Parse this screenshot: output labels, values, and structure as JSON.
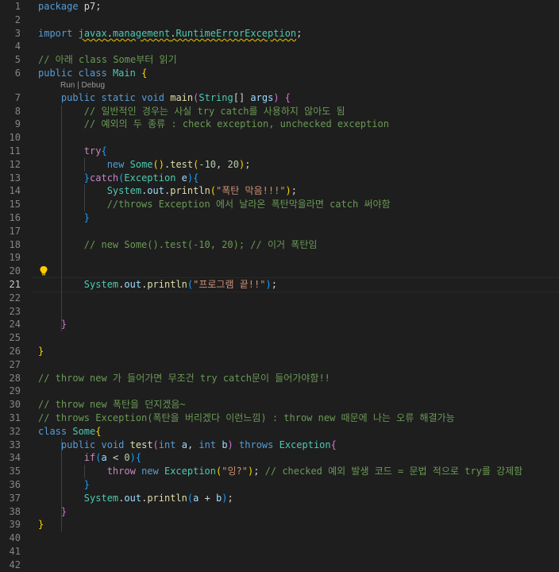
{
  "editor": {
    "active_line": 21,
    "codelens": {
      "run": "Run",
      "sep": "|",
      "debug": "Debug"
    },
    "lightbulb_icon": "lightbulb-icon",
    "colors": {
      "background": "#1e1e1e",
      "keyword": "#569cd6",
      "type": "#4ec9b0",
      "string": "#ce9178",
      "comment": "#6a9955",
      "number": "#b5cea8"
    },
    "line_numbers": [
      "1",
      "2",
      "3",
      "4",
      "5",
      "6",
      "7",
      "8",
      "9",
      "10",
      "11",
      "12",
      "13",
      "14",
      "15",
      "16",
      "17",
      "18",
      "19",
      "20",
      "21",
      "22",
      "23",
      "24",
      "25",
      "26",
      "27",
      "28",
      "29",
      "30",
      "31",
      "32",
      "33",
      "34",
      "35",
      "36",
      "37",
      "38",
      "39",
      "40",
      "41",
      "42"
    ],
    "lines": [
      [
        [
          "k",
          "package"
        ],
        [
          "p",
          " p7;"
        ]
      ],
      [],
      [
        [
          "k",
          "import"
        ],
        [
          "p",
          " "
        ],
        [
          "t warn",
          "javax"
        ],
        [
          "p warn",
          "."
        ],
        [
          "t warn",
          "management"
        ],
        [
          "p warn",
          "."
        ],
        [
          "t warn",
          "RuntimeErrorException"
        ],
        [
          "p",
          ";"
        ]
      ],
      [],
      [
        [
          "c",
          "// 아래 class Some부터 읽기"
        ]
      ],
      [
        [
          "k",
          "public"
        ],
        [
          "p",
          " "
        ],
        [
          "k",
          "class"
        ],
        [
          "p",
          " "
        ],
        [
          "t",
          "Main"
        ],
        [
          "p",
          " "
        ],
        [
          "b1",
          "{"
        ]
      ],
      [
        [
          "p",
          "    "
        ],
        [
          "k",
          "public"
        ],
        [
          "p",
          " "
        ],
        [
          "k",
          "static"
        ],
        [
          "p",
          " "
        ],
        [
          "k",
          "void"
        ],
        [
          "p",
          " "
        ],
        [
          "f",
          "main"
        ],
        [
          "b2",
          "("
        ],
        [
          "t",
          "String"
        ],
        [
          "p",
          "[] "
        ],
        [
          "v",
          "args"
        ],
        [
          "b2",
          ")"
        ],
        [
          "p",
          " "
        ],
        [
          "b2",
          "{"
        ]
      ],
      [
        [
          "p",
          "        "
        ],
        [
          "c",
          "// 일반적인 경우는 사실 try catch를 사용하지 않아도 됨"
        ]
      ],
      [
        [
          "p",
          "        "
        ],
        [
          "c",
          "// 예외의 두 종류 : check exception, unchecked exception"
        ]
      ],
      [],
      [
        [
          "p",
          "        "
        ],
        [
          "kc",
          "try"
        ],
        [
          "b3",
          "{"
        ]
      ],
      [
        [
          "p",
          "            "
        ],
        [
          "k",
          "new"
        ],
        [
          "p",
          " "
        ],
        [
          "t",
          "Some"
        ],
        [
          "b1",
          "()"
        ],
        [
          "p",
          "."
        ],
        [
          "f",
          "test"
        ],
        [
          "b1",
          "("
        ],
        [
          "n",
          "-10"
        ],
        [
          "p",
          ", "
        ],
        [
          "n",
          "20"
        ],
        [
          "b1",
          ")"
        ],
        [
          "p",
          ";"
        ]
      ],
      [
        [
          "p",
          "        "
        ],
        [
          "b3",
          "}"
        ],
        [
          "kc",
          "catch"
        ],
        [
          "b3",
          "("
        ],
        [
          "t",
          "Exception"
        ],
        [
          "p",
          " "
        ],
        [
          "v",
          "e"
        ],
        [
          "b3",
          ")"
        ],
        [
          "b3",
          "{"
        ]
      ],
      [
        [
          "p",
          "            "
        ],
        [
          "t",
          "System"
        ],
        [
          "p",
          "."
        ],
        [
          "v",
          "out"
        ],
        [
          "p",
          "."
        ],
        [
          "f",
          "println"
        ],
        [
          "b1",
          "("
        ],
        [
          "s",
          "\"폭탄 막음!!!\""
        ],
        [
          "b1",
          ")"
        ],
        [
          "p",
          ";"
        ]
      ],
      [
        [
          "p",
          "            "
        ],
        [
          "c",
          "//throws Exception 에서 날라온 폭탄막을라면 catch 써야함"
        ]
      ],
      [
        [
          "p",
          "        "
        ],
        [
          "b3",
          "}"
        ]
      ],
      [],
      [
        [
          "p",
          "        "
        ],
        [
          "c",
          "// new Some().test(-10, 20); // 이거 폭탄임"
        ]
      ],
      [],
      [],
      [
        [
          "p",
          "        "
        ],
        [
          "t",
          "System"
        ],
        [
          "p",
          "."
        ],
        [
          "v",
          "out"
        ],
        [
          "p",
          "."
        ],
        [
          "f",
          "println"
        ],
        [
          "b3",
          "("
        ],
        [
          "s",
          "\"프로그램 끝!!\""
        ],
        [
          "b3",
          ")"
        ],
        [
          "p",
          ";"
        ]
      ],
      [],
      [],
      [
        [
          "p",
          "    "
        ],
        [
          "b2",
          "}"
        ]
      ],
      [],
      [
        [
          "b1",
          "}"
        ]
      ],
      [],
      [
        [
          "c",
          "// throw new 가 들어가면 무조건 try catch문이 들어가야함!!"
        ]
      ],
      [],
      [
        [
          "c",
          "// throw new 폭탄을 던지겠음~"
        ]
      ],
      [
        [
          "c",
          "// throws Exception(폭탄을 버리겠다 이런느낌) : throw new 때문에 나는 오류 해결가능"
        ]
      ],
      [
        [
          "k",
          "class"
        ],
        [
          "p",
          " "
        ],
        [
          "t",
          "Some"
        ],
        [
          "b1",
          "{"
        ]
      ],
      [
        [
          "p",
          "    "
        ],
        [
          "k",
          "public"
        ],
        [
          "p",
          " "
        ],
        [
          "k",
          "void"
        ],
        [
          "p",
          " "
        ],
        [
          "f",
          "test"
        ],
        [
          "b2",
          "("
        ],
        [
          "k",
          "int"
        ],
        [
          "p",
          " "
        ],
        [
          "v",
          "a"
        ],
        [
          "p",
          ", "
        ],
        [
          "k",
          "int"
        ],
        [
          "p",
          " "
        ],
        [
          "v",
          "b"
        ],
        [
          "b2",
          ")"
        ],
        [
          "p",
          " "
        ],
        [
          "k",
          "throws"
        ],
        [
          "p",
          " "
        ],
        [
          "t",
          "Exception"
        ],
        [
          "b2",
          "{"
        ]
      ],
      [
        [
          "p",
          "        "
        ],
        [
          "kc",
          "if"
        ],
        [
          "b3",
          "("
        ],
        [
          "v",
          "a"
        ],
        [
          "p",
          " < "
        ],
        [
          "n",
          "0"
        ],
        [
          "b3",
          ")"
        ],
        [
          "b3",
          "{"
        ]
      ],
      [
        [
          "p",
          "            "
        ],
        [
          "kc",
          "throw"
        ],
        [
          "p",
          " "
        ],
        [
          "k",
          "new"
        ],
        [
          "p",
          " "
        ],
        [
          "t",
          "Exception"
        ],
        [
          "b1",
          "("
        ],
        [
          "s",
          "\"잉?\""
        ],
        [
          "b1",
          ")"
        ],
        [
          "p",
          "; "
        ],
        [
          "c",
          "// checked 예외 발생 코드 = 문법 적으로 try를 강제함"
        ]
      ],
      [
        [
          "p",
          "        "
        ],
        [
          "b3",
          "}"
        ]
      ],
      [
        [
          "p",
          "        "
        ],
        [
          "t",
          "System"
        ],
        [
          "p",
          "."
        ],
        [
          "v",
          "out"
        ],
        [
          "p",
          "."
        ],
        [
          "f",
          "println"
        ],
        [
          "b3",
          "("
        ],
        [
          "v",
          "a"
        ],
        [
          "p",
          " + "
        ],
        [
          "v",
          "b"
        ],
        [
          "b3",
          ")"
        ],
        [
          "p",
          ";"
        ]
      ],
      [
        [
          "p",
          "    "
        ],
        [
          "b2",
          "}"
        ]
      ],
      [
        [
          "b1",
          "}"
        ]
      ],
      [],
      [],
      []
    ]
  }
}
